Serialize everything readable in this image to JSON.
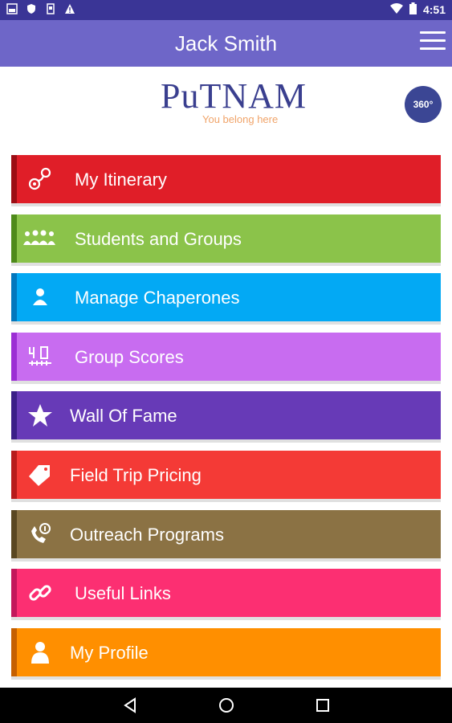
{
  "status": {
    "time": "4:51"
  },
  "header": {
    "title": "Jack Smith"
  },
  "logo": {
    "brand_text": "PuTNAM",
    "tagline": "You belong here",
    "badge": "360°"
  },
  "menu": [
    {
      "label": "My Itinerary",
      "icon": "itinerary-icon",
      "color": "#e01e28",
      "strip": "#9c0d14"
    },
    {
      "label": "Students and Groups",
      "icon": "students-groups-icon",
      "color": "#8bc34a",
      "strip": "#4e8a1a"
    },
    {
      "label": "Manage Chaperones",
      "icon": "chaperone-icon",
      "color": "#03a9f4",
      "strip": "#0277bd"
    },
    {
      "label": "Group Scores",
      "icon": "scores-icon",
      "color": "#c86cf0",
      "strip": "#9c2fd4"
    },
    {
      "label": "Wall Of Fame",
      "icon": "star-icon",
      "color": "#673ab7",
      "strip": "#3b1f88"
    },
    {
      "label": "Field Trip Pricing",
      "icon": "price-tag-icon",
      "color": "#f43a36",
      "strip": "#b71c1c"
    },
    {
      "label": "Outreach Programs",
      "icon": "phone-dollar-icon",
      "color": "#8b7244",
      "strip": "#5a4722"
    },
    {
      "label": "Useful Links",
      "icon": "link-icon",
      "color": "#fc2f72",
      "strip": "#c2185b"
    },
    {
      "label": "My Profile",
      "icon": "profile-icon",
      "color": "#ff8f00",
      "strip": "#c56000"
    }
  ]
}
